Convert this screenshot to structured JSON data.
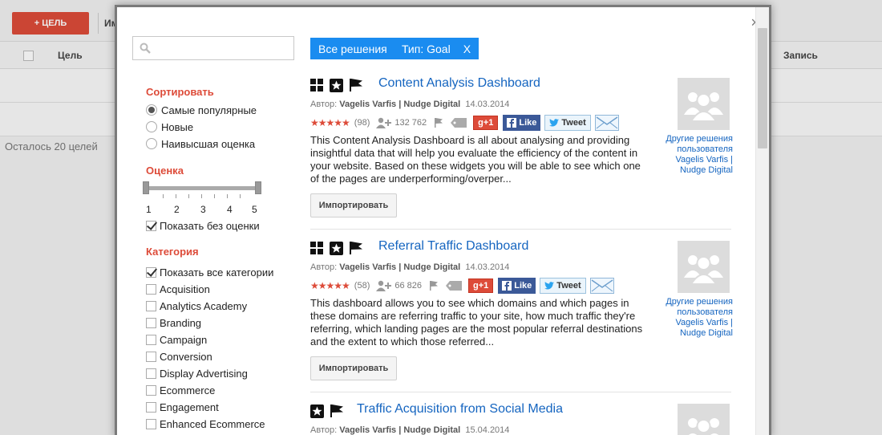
{
  "background": {
    "add_goal_button": "+ ЦЕЛЬ",
    "toolbar_partial": "Им",
    "col_goal": "Цель",
    "col_records": "Запись",
    "remaining": "Осталось 20 целей"
  },
  "modal": {
    "close": "×",
    "search": {
      "placeholder": ""
    },
    "sort": {
      "heading": "Сортировать",
      "options": [
        {
          "label": "Самые популярные",
          "selected": true
        },
        {
          "label": "Новые",
          "selected": false
        },
        {
          "label": "Наивысшая оценка",
          "selected": false
        }
      ]
    },
    "rating": {
      "heading": "Оценка",
      "scale": [
        "1",
        "2",
        "3",
        "4",
        "5"
      ],
      "show_unrated": "Показать без оценки"
    },
    "category": {
      "heading": "Категория",
      "show_all": "Показать все категории",
      "items": [
        "Acquisition",
        "Analytics Academy",
        "Branding",
        "Campaign",
        "Conversion",
        "Display Advertising",
        "Ecommerce",
        "Engagement",
        "Enhanced Ecommerce"
      ]
    },
    "filters": {
      "all_solutions": "Все решения",
      "type_filter": "Тип: Goal",
      "type_filter_remove": "X"
    },
    "results": [
      {
        "title": "Content Analysis Dashboard",
        "author_label": "Автор:",
        "author": "Vagelis Varfis | Nudge Digital",
        "date": "14.03.2014",
        "stars": "★★★★★",
        "reviews": "(98)",
        "users": "132 762",
        "gplus": "g+1",
        "like": "Like",
        "tweet": "Tweet",
        "description": "This Content Analysis Dashboard is all about analysing and providing insightful data that will help you evaluate the efficiency of the content in your website. Based on these widgets you will be able to see which one of the pages are underperforming/overper...",
        "import": "Импортировать",
        "other": "Другие решения пользователя Vagelis Varfis | Nudge Digital"
      },
      {
        "title": "Referral Traffic Dashboard",
        "author_label": "Автор:",
        "author": "Vagelis Varfis | Nudge Digital",
        "date": "14.03.2014",
        "stars": "★★★★★",
        "reviews": "(58)",
        "users": "66 826",
        "gplus": "g+1",
        "like": "Like",
        "tweet": "Tweet",
        "description": "This dashboard allows you to see which domains and which pages in these domains are referring traffic to your site, how much traffic they're referring, which landing pages are the most popular referral destinations and the extent to which those referred...",
        "import": "Импортировать",
        "other": "Другие решения пользователя Vagelis Varfis | Nudge Digital"
      },
      {
        "title": "Traffic Acquisition from Social Media",
        "author_label": "Автор:",
        "author": "Vagelis Varfis | Nudge Digital",
        "date": "15.04.2014"
      }
    ]
  },
  "colors": {
    "accent_red": "#dd4b39",
    "pill_blue": "#1a8cf0",
    "link_blue": "#1565c0"
  }
}
